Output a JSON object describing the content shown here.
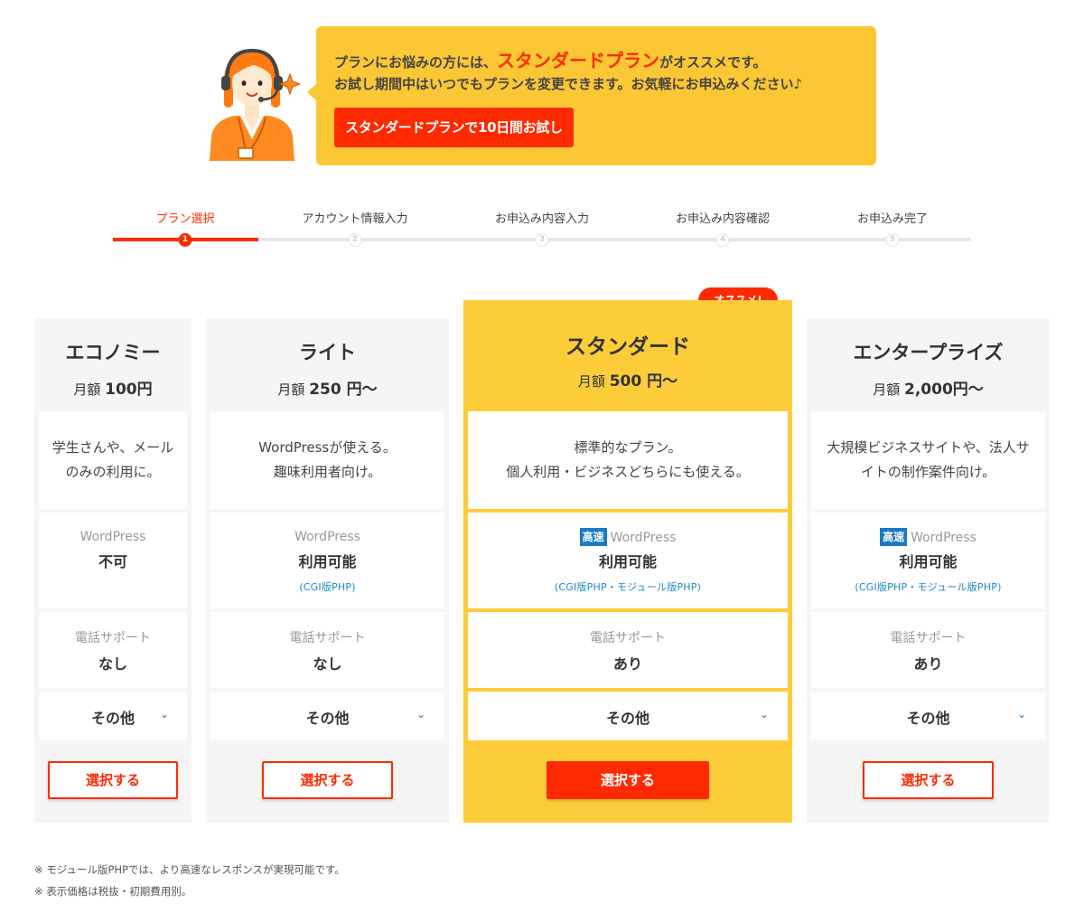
{
  "banner": {
    "line1_pre": "プランにお悩みの方には、",
    "line1_em": "スタンダードプラン",
    "line1_post": "がオススメです。",
    "line2": "お試し期間中はいつでもプランを変更できます。お気軽にお申込みください♪",
    "trial_button": "スタンダードプランで10日間お試し"
  },
  "steps": [
    {
      "num": "1",
      "label": "プラン選択",
      "active": true
    },
    {
      "num": "2",
      "label": "アカウント情報入力",
      "active": false
    },
    {
      "num": "3",
      "label": "お申込み内容入力",
      "active": false
    },
    {
      "num": "4",
      "label": "お申込み内容確認",
      "active": false
    },
    {
      "num": "5",
      "label": "お申込み完了",
      "active": false
    }
  ],
  "recommend_badge": "オススメ!",
  "plans": [
    {
      "name": "エコノミー",
      "price_prefix": "月額",
      "price_amount": "100円",
      "price_suffix": "",
      "desc1": "学生さんや、メール",
      "desc2": "のみの利用に。",
      "wp_label": "WordPress",
      "wp_value": "不可",
      "wp_note": "",
      "phone_label": "電話サポート",
      "phone_value": "なし",
      "other_label": "その他",
      "select_label": "選択する"
    },
    {
      "name": "ライト",
      "price_prefix": "月額",
      "price_amount": "250 円",
      "price_suffix": "〜",
      "desc1": "WordPressが使える。",
      "desc2": "趣味利用者向け。",
      "wp_label": "WordPress",
      "wp_value": "利用可能",
      "wp_note": "(CGI版PHP)",
      "phone_label": "電話サポート",
      "phone_value": "なし",
      "other_label": "その他",
      "select_label": "選択する"
    },
    {
      "name": "スタンダード",
      "price_prefix": "月額",
      "price_amount": "500 円",
      "price_suffix": "〜",
      "desc1": "標準的なプラン。",
      "desc2": "個人利用・ビジネスどちらにも使える。",
      "fast_badge": "高速",
      "wp_label": "WordPress",
      "wp_value": "利用可能",
      "wp_note": "(CGI版PHP・モジュール版PHP)",
      "phone_label": "電話サポート",
      "phone_value": "あり",
      "other_label": "その他",
      "select_label": "選択する"
    },
    {
      "name": "エンタープライズ",
      "price_prefix": "月額",
      "price_amount": "2,000円",
      "price_suffix": "〜",
      "desc1": "大規模ビジネスサイトや、法人サ",
      "desc2": "イトの制作案件向け。",
      "fast_badge": "高速",
      "wp_label": "WordPress",
      "wp_value": "利用可能",
      "wp_note": "(CGI版PHP・モジュール版PHP)",
      "phone_label": "電話サポート",
      "phone_value": "あり",
      "other_label": "その他",
      "select_label": "選択する"
    }
  ],
  "notes": [
    "※ モジュール版PHPでは、より高速なレスポンスが実現可能です。",
    "※ 表示価格は税抜・初期費用別。"
  ],
  "colors": {
    "accent_red": "#ff2a00",
    "featured_yellow": "#fdcd39",
    "banner_yellow": "#fbc734",
    "link_blue": "#1b7ac4"
  }
}
